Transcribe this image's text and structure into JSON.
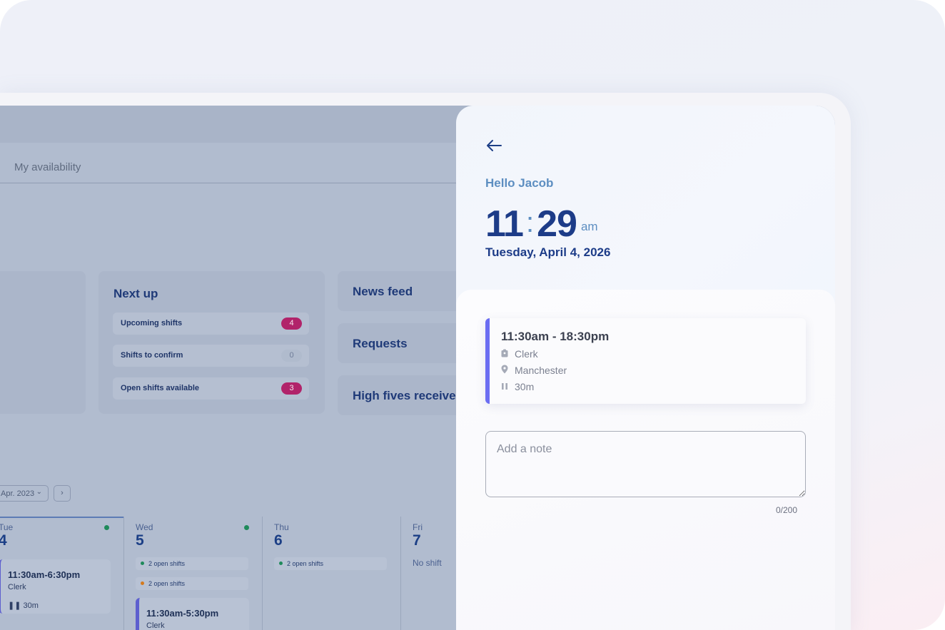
{
  "dashboard": {
    "tab_label": "My availability",
    "next_up": {
      "title": "Next up",
      "rows": [
        {
          "label": "Upcoming shifts",
          "count": "4"
        },
        {
          "label": "Shifts to confirm",
          "count": "0"
        },
        {
          "label": "Open shifts available",
          "count": "3"
        }
      ]
    },
    "news_feed_title": "News feed",
    "requests_title": "Requests",
    "high_fives_title": "High fives received",
    "date_selector": "Apr. 2023",
    "days": [
      {
        "name": "Tue",
        "num": "4"
      },
      {
        "name": "Wed",
        "num": "5"
      },
      {
        "name": "Thu",
        "num": "6"
      },
      {
        "name": "Fri",
        "num": "7",
        "status": "No shift"
      }
    ],
    "open_shifts_label": "2 open shifts",
    "tue_shift": {
      "time": "11:30am-6:30pm",
      "role": "Clerk",
      "break": "30m"
    },
    "wed_shift": {
      "time": "11:30am-5:30pm",
      "role": "Clerk"
    },
    "colors": {
      "green_dot": "#1f8a5b",
      "orange_dot": "#d47a1e",
      "badge_pink": "#b1236a"
    }
  },
  "panel": {
    "greeting": "Hello Jacob",
    "clock": {
      "hours": "11",
      "minutes": "29",
      "ampm": "am"
    },
    "date": "Tuesday, April 4, 2026",
    "shift": {
      "time": "11:30am - 18:30pm",
      "role": "Clerk",
      "location": "Manchester",
      "break": "30m",
      "accent": "#6b6df2"
    },
    "note": {
      "placeholder": "Add a note",
      "counter": "0/200"
    }
  }
}
